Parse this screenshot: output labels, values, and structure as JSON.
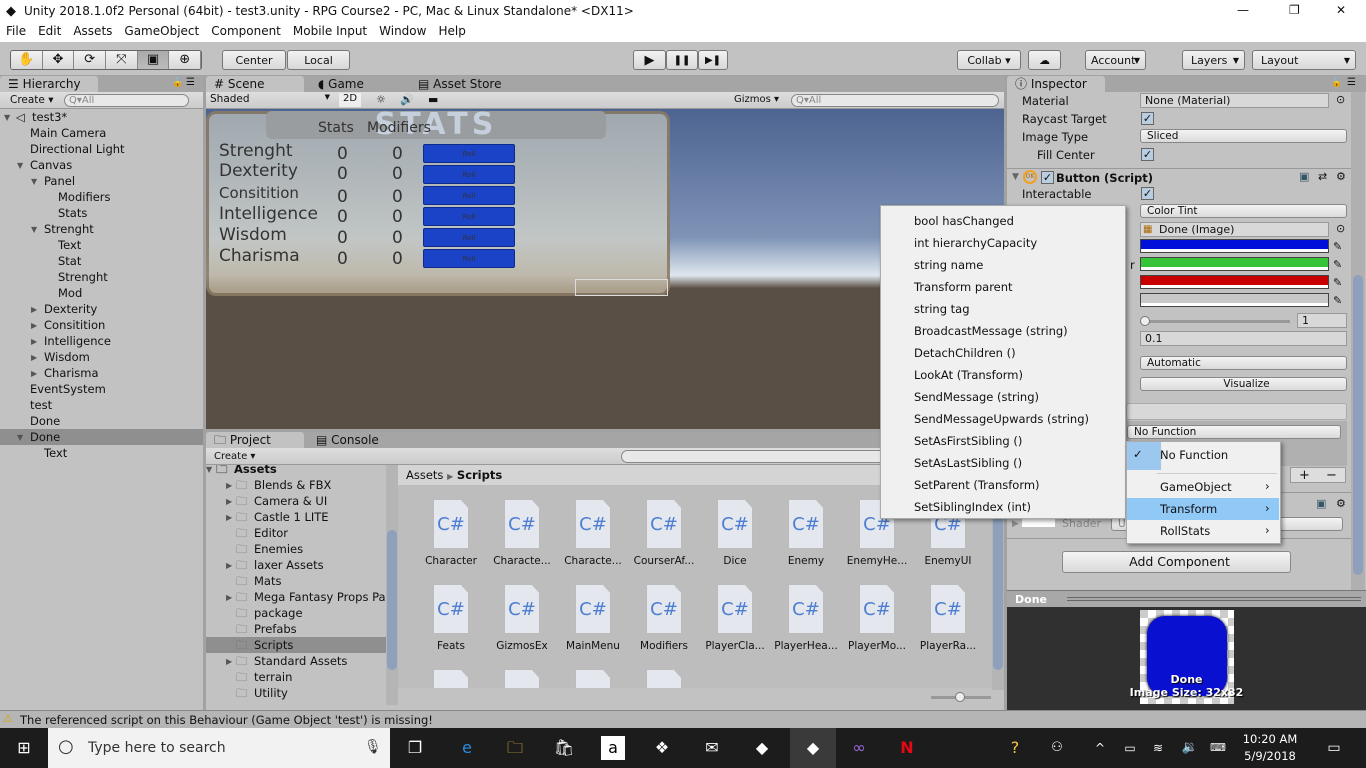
{
  "window": {
    "title": "Unity 2018.1.0f2 Personal (64bit) - test3.unity - RPG Course2 - PC, Mac & Linux Standalone* <DX11>",
    "minimize": "—",
    "maximize": "❐",
    "close": "✕"
  },
  "menu": [
    "File",
    "Edit",
    "Assets",
    "GameObject",
    "Component",
    "Mobile Input",
    "Window",
    "Help"
  ],
  "toolbar": {
    "tools": [
      "hand-tool",
      "move-tool",
      "rotate-tool",
      "scale-tool",
      "rect-tool",
      "transform-tool"
    ],
    "tool_glyphs": [
      "✋",
      "✥",
      "⟳",
      "⤧",
      "▣",
      "⊕"
    ],
    "pivot": "Center",
    "space": "Local",
    "play": "▶",
    "pause": "❚❚",
    "step": "▶❚",
    "collab": "Collab ▾",
    "cloud": "☁",
    "account": "Account",
    "layers": "Layers",
    "layout": "Layout"
  },
  "hierarchy": {
    "tab": "Hierarchy",
    "create": "Create",
    "search_placeholder": "Q▾All",
    "scene": "test3*",
    "items": [
      {
        "label": "Main Camera",
        "depth": 1,
        "arrow": ""
      },
      {
        "label": "Directional Light",
        "depth": 1,
        "arrow": ""
      },
      {
        "label": "Canvas",
        "depth": 1,
        "arrow": "down"
      },
      {
        "label": "Panel",
        "depth": 2,
        "arrow": "down"
      },
      {
        "label": "Modifiers",
        "depth": 3,
        "arrow": ""
      },
      {
        "label": "Stats",
        "depth": 3,
        "arrow": ""
      },
      {
        "label": "Strenght",
        "depth": 2,
        "arrow": "down"
      },
      {
        "label": "Text",
        "depth": 3,
        "arrow": ""
      },
      {
        "label": "Stat",
        "depth": 3,
        "arrow": ""
      },
      {
        "label": "Strenght",
        "depth": 3,
        "arrow": ""
      },
      {
        "label": "Mod",
        "depth": 3,
        "arrow": ""
      },
      {
        "label": "Dexterity",
        "depth": 2,
        "arrow": "right"
      },
      {
        "label": "Consitition",
        "depth": 2,
        "arrow": "right"
      },
      {
        "label": "Intelligence",
        "depth": 2,
        "arrow": "right"
      },
      {
        "label": "Wisdom",
        "depth": 2,
        "arrow": "right"
      },
      {
        "label": "Charisma",
        "depth": 2,
        "arrow": "right"
      },
      {
        "label": "EventSystem",
        "depth": 1,
        "arrow": ""
      },
      {
        "label": "test",
        "depth": 1,
        "arrow": ""
      },
      {
        "label": "Done",
        "depth": 1,
        "arrow": ""
      },
      {
        "label": "Done",
        "depth": 1,
        "arrow": "down",
        "selected": true
      },
      {
        "label": "Text",
        "depth": 2,
        "arrow": ""
      }
    ]
  },
  "scene": {
    "tabs": [
      "Scene",
      "Game",
      "Asset Store"
    ],
    "shading": "Shaded",
    "mode_2d": "2D",
    "gizmos": "Gizmos",
    "search_placeholder": "Q▾All",
    "panel_title": "STATS",
    "col_stats": "Stats",
    "col_modifiers": "Modifiers",
    "rows": [
      {
        "name": "Strenght",
        "stat": "0",
        "mod": "0",
        "button": "Roll"
      },
      {
        "name": "Dexterity",
        "stat": "0",
        "mod": "0",
        "button": "Roll"
      },
      {
        "name": "Consitition",
        "stat": "0",
        "mod": "0",
        "button": "Roll"
      },
      {
        "name": "Intelligence",
        "stat": "0",
        "mod": "0",
        "button": "Roll"
      },
      {
        "name": "Wisdom",
        "stat": "0",
        "mod": "0",
        "button": "Roll"
      },
      {
        "name": "Charisma",
        "stat": "0",
        "mod": "0",
        "button": "Roll"
      }
    ]
  },
  "project": {
    "tabs": [
      "Project",
      "Console"
    ],
    "create": "Create",
    "folders": [
      {
        "label": "Assets",
        "depth": 0,
        "arrow": "down"
      },
      {
        "label": "Blends & FBX",
        "depth": 1,
        "arrow": "right"
      },
      {
        "label": "Camera & UI",
        "depth": 1,
        "arrow": "right"
      },
      {
        "label": "Castle 1 LITE",
        "depth": 1,
        "arrow": "right"
      },
      {
        "label": "Editor",
        "depth": 1,
        "arrow": ""
      },
      {
        "label": "Enemies",
        "depth": 1,
        "arrow": ""
      },
      {
        "label": "laxer Assets",
        "depth": 1,
        "arrow": "right"
      },
      {
        "label": "Mats",
        "depth": 1,
        "arrow": ""
      },
      {
        "label": "Mega Fantasy Props Pa",
        "depth": 1,
        "arrow": "right"
      },
      {
        "label": "package",
        "depth": 1,
        "arrow": ""
      },
      {
        "label": "Prefabs",
        "depth": 1,
        "arrow": ""
      },
      {
        "label": "Scripts",
        "depth": 1,
        "arrow": "",
        "selected": true
      },
      {
        "label": "Standard Assets",
        "depth": 1,
        "arrow": "right"
      },
      {
        "label": "terrain",
        "depth": 1,
        "arrow": ""
      },
      {
        "label": "Utility",
        "depth": 1,
        "arrow": ""
      }
    ],
    "breadcrumb": [
      "Assets",
      "Scripts"
    ],
    "files": [
      "Character",
      "Characte...",
      "Characte...",
      "CourserAf...",
      "Dice",
      "Enemy",
      "EnemyHe...",
      "EnemyUI",
      "Feats",
      "GizmosEx",
      "MainMenu",
      "Modifiers",
      "PlayerCla...",
      "PlayerHea...",
      "PlayerMo...",
      "PlayerRa...",
      "",
      "",
      "",
      ""
    ],
    "file_icon": "C#"
  },
  "inspector": {
    "tab": "Inspector",
    "material_label": "Material",
    "material_value": "None (Material)",
    "raycast_label": "Raycast Target",
    "image_type_label": "Image Type",
    "image_type_value": "Sliced",
    "fill_center_label": "Fill Center",
    "button_header": "Button (Script)",
    "interactable_label": "Interactable",
    "transition_value": "Color Tint",
    "target_value": "Done (Image)",
    "colors": {
      "normal": "#0010d8",
      "highlighted": "#38c438",
      "pressed": "#c80000",
      "disabled": "#c8c8c8"
    },
    "highlight_label_fragment": "r",
    "multiplier_value": "1",
    "fade_value": "0.1",
    "navigation_value": "Automatic",
    "visualize": "Visualize",
    "onclick_function": "No Function",
    "plus": "+",
    "minus": "−",
    "shader_label": "Shader",
    "shader_value": "U",
    "add_component": "Add Component"
  },
  "preview": {
    "name": "Done",
    "label": "Done",
    "size": "Image Size: 32x32"
  },
  "context_menu": {
    "items": [
      "bool hasChanged",
      "int hierarchyCapacity",
      "string name",
      "Transform parent",
      "string tag",
      "BroadcastMessage (string)",
      "DetachChildren ()",
      "LookAt (Transform)",
      "SendMessage (string)",
      "SendMessageUpwards (string)",
      "SetAsFirstSibling ()",
      "SetAsLastSibling ()",
      "SetParent (Transform)",
      "SetSiblingIndex (int)"
    ]
  },
  "function_menu": {
    "checked": "No Function",
    "items": [
      "GameObject",
      "Transform",
      "RollStats"
    ],
    "highlighted": "Transform"
  },
  "status": {
    "message": "The referenced script on this Behaviour (Game Object 'test') is missing!"
  },
  "taskbar": {
    "search_placeholder": "Type here to search",
    "time": "10:20 AM",
    "date": "5/9/2018"
  }
}
